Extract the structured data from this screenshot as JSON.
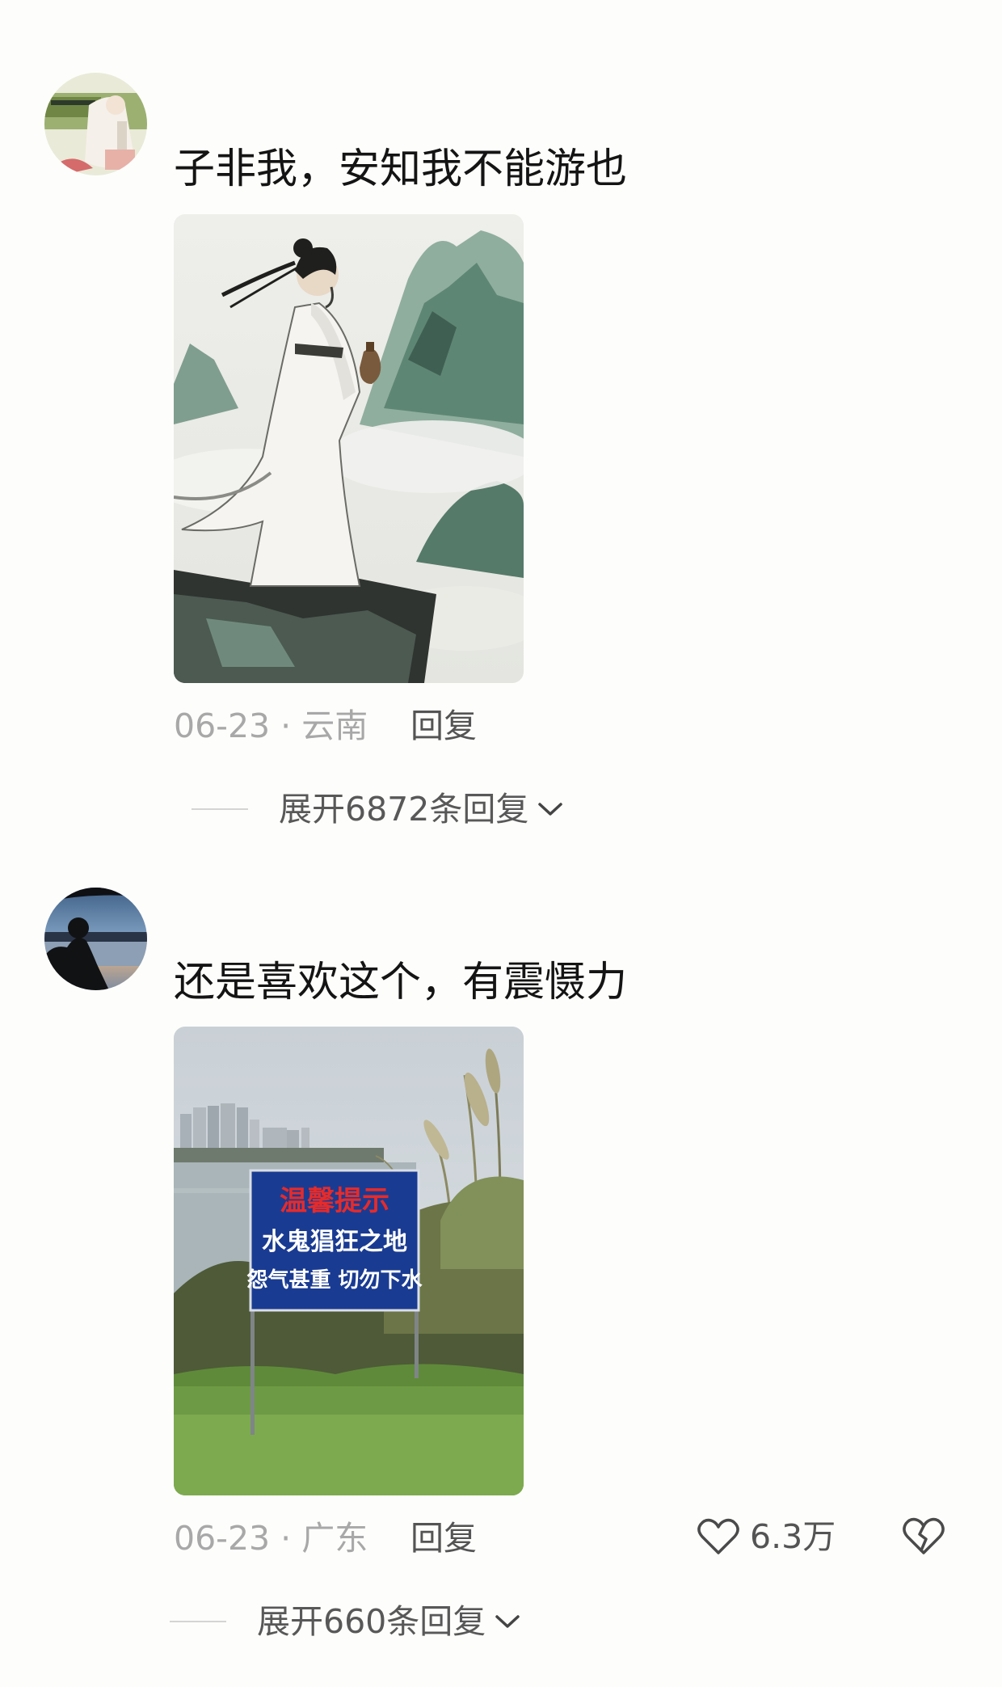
{
  "comments": [
    {
      "text": "子非我，安知我不能游也",
      "date_location": "06-23 · 云南",
      "reply_label": "回复",
      "expand_label": "展开6872条回复"
    },
    {
      "text": "还是喜欢这个，有震慑力",
      "date_location": "06-23 · 广东",
      "reply_label": "回复",
      "like_count": "6.3万",
      "expand_label": "展开660条回复",
      "sign": {
        "title": "温馨提示",
        "line1": "水鬼猖狂之地",
        "line2": "怨气甚重  切勿下水"
      }
    }
  ]
}
